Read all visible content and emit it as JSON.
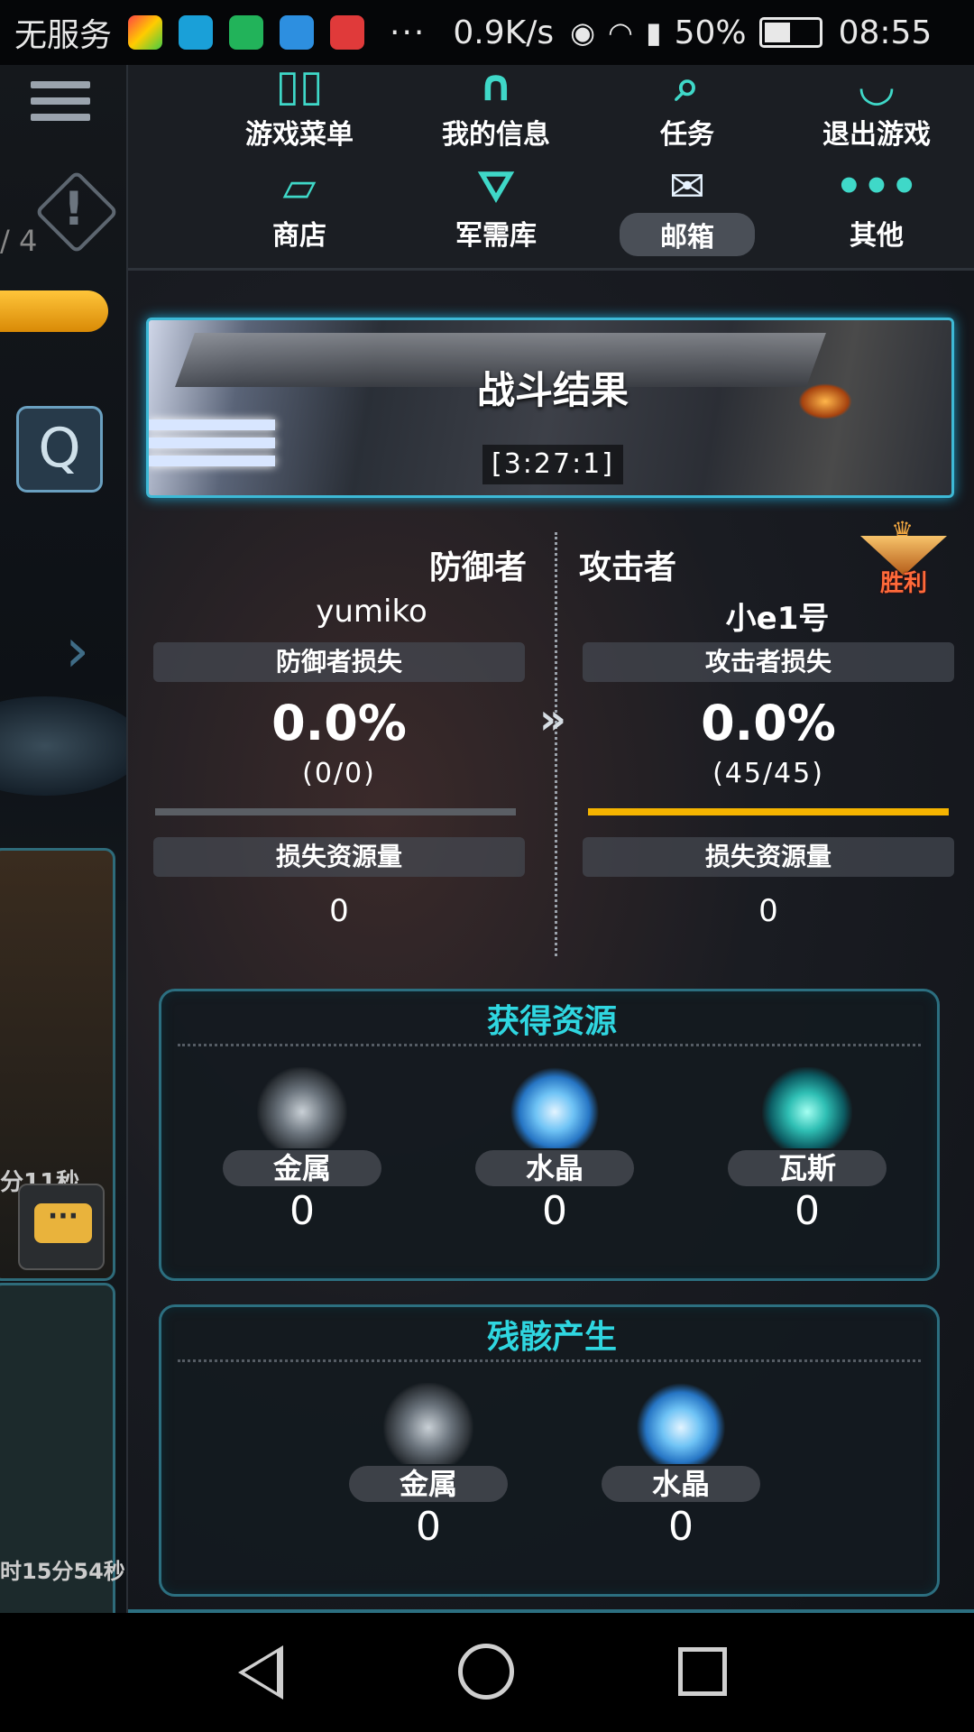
{
  "status_bar": {
    "carrier": "无服务",
    "overflow": "···",
    "speed": "0.9K/s",
    "battery": "50%",
    "battery_level": 0.5,
    "time": "08:55"
  },
  "left_strip": {
    "count_text": "/ 4",
    "search_key": "Q",
    "timer1": "分11秒",
    "timer2": "时15分54秒"
  },
  "menu": {
    "items": [
      {
        "label": "游戏菜单",
        "icon": "game-menu-icon"
      },
      {
        "label": "我的信息",
        "icon": "profile-icon"
      },
      {
        "label": "任务",
        "icon": "quest-icon"
      },
      {
        "label": "退出游戏",
        "icon": "exit-icon"
      },
      {
        "label": "商店",
        "icon": "shop-card-icon"
      },
      {
        "label": "军需库",
        "icon": "supply-icon"
      },
      {
        "label": "邮箱",
        "icon": "mail-icon",
        "active": true
      },
      {
        "label": "其他",
        "icon": "more-icon"
      }
    ]
  },
  "battle": {
    "title": "战斗结果",
    "coords": "[3:27:1]",
    "defender": {
      "role": "防御者",
      "name": "yumiko",
      "loss_label": "防御者损失",
      "loss_percent": "0.0%",
      "loss_ratio": "(0/0)",
      "resource_label": "损失资源量",
      "resource_value": "0"
    },
    "attacker": {
      "role": "攻击者",
      "name": "小e1号",
      "loss_label": "攻击者损失",
      "loss_percent": "0.0%",
      "loss_ratio": "(45/45)",
      "resource_label": "损失资源量",
      "resource_value": "0"
    },
    "result_badge": "胜利"
  },
  "gained": {
    "title": "获得资源",
    "items": [
      {
        "label": "金属",
        "value": "0",
        "icon": "metal-icon"
      },
      {
        "label": "水晶",
        "value": "0",
        "icon": "crystal-icon"
      },
      {
        "label": "瓦斯",
        "value": "0",
        "icon": "gas-icon"
      }
    ]
  },
  "debris": {
    "title": "残骸产生",
    "items": [
      {
        "label": "金属",
        "value": "0",
        "icon": "metal-icon"
      },
      {
        "label": "水晶",
        "value": "0",
        "icon": "crystal-icon"
      }
    ]
  },
  "colors": {
    "accent_teal": "#2fd6e0",
    "banner_border": "#3db9d6",
    "attacker_bar": "#f5b400",
    "defender_bar": "#5a5e64"
  }
}
